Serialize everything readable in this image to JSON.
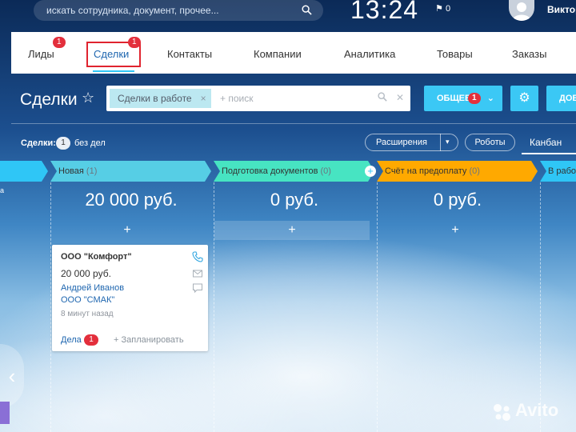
{
  "topbar": {
    "search_placeholder": "искать сотрудника, документ, прочее...",
    "clock": "13:24",
    "flag_count": "0",
    "user_name": "Виктор"
  },
  "nav": {
    "tabs": [
      {
        "label": "Лиды",
        "badge": "1"
      },
      {
        "label": "Сделки",
        "badge": "1"
      },
      {
        "label": "Контакты"
      },
      {
        "label": "Компании"
      },
      {
        "label": "Аналитика"
      },
      {
        "label": "Товары"
      },
      {
        "label": "Заказы"
      }
    ]
  },
  "toolbar": {
    "title": "Сделки",
    "filter_tag": "Сделки в работе",
    "filter_tag_remove": "×",
    "filter_placeholder": "+ поиск",
    "general_label": "ОБЩЕЕ",
    "general_badge": "1",
    "add_label": "ДОБ"
  },
  "counters": {
    "label": "Сделки:",
    "count": "1",
    "text": "без дел",
    "extensions": "Расширения",
    "robots": "Роботы",
    "kanban": "Канбан"
  },
  "stages": [
    {
      "name": "Новая",
      "count": "(1)",
      "sum": "20 000 руб.",
      "color": "#56cee5"
    },
    {
      "name": "Подготовка документов",
      "count": "(0)",
      "sum": "0 руб.",
      "color": "#47e4c2"
    },
    {
      "name": "Счёт на предоплату",
      "count": "(0)",
      "sum": "0 руб.",
      "color": "#ffa900"
    },
    {
      "name": "В работе",
      "count": "",
      "sum": "",
      "color": "#2fc6f6"
    }
  ],
  "deal_card": {
    "title": "ООО \"Комфорт\"",
    "sum": "20 000 руб.",
    "contact": "Андрей Иванов",
    "company": "ООО \"СМАК\"",
    "time": "8 минут назад",
    "tasks_label": "Дела",
    "tasks_badge": "1",
    "plan_label": "+ Запланировать"
  },
  "watermark": "Avito",
  "side_label": "а"
}
